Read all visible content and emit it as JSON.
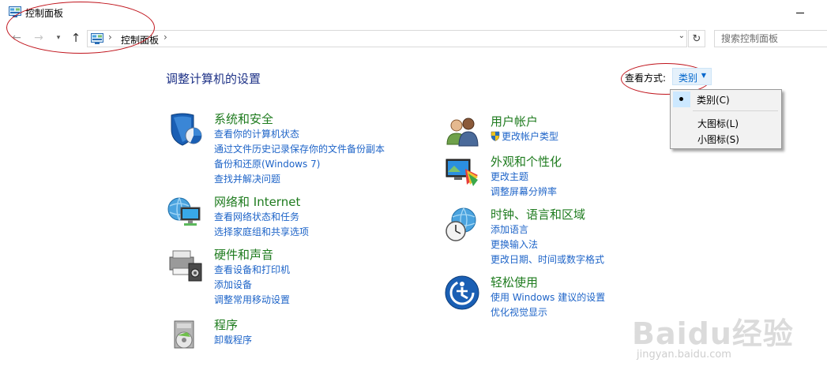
{
  "window": {
    "title": "控制面板"
  },
  "nav": {
    "breadcrumb": "控制面板",
    "search_placeholder": "搜索控制面板"
  },
  "main": {
    "heading": "调整计算机的设置",
    "view_by_label": "查看方式:",
    "view_by_value": "类别"
  },
  "view_menu": {
    "items": [
      "类别(C)",
      "大图标(L)",
      "小图标(S)"
    ],
    "selected": "类别(C)"
  },
  "categories": [
    {
      "title": "系统和安全",
      "icon": "system-security-icon",
      "links": [
        "查看你的计算机状态",
        "通过文件历史记录保存你的文件备份副本",
        "备份和还原(Windows 7)",
        "查找并解决问题"
      ]
    },
    {
      "title": "网络和 Internet",
      "icon": "network-internet-icon",
      "links": [
        "查看网络状态和任务",
        "选择家庭组和共享选项"
      ]
    },
    {
      "title": "硬件和声音",
      "icon": "hardware-sound-icon",
      "links": [
        "查看设备和打印机",
        "添加设备",
        "调整常用移动设置"
      ]
    },
    {
      "title": "程序",
      "icon": "programs-icon",
      "links": [
        "卸载程序"
      ]
    },
    {
      "title": "用户帐户",
      "icon": "user-accounts-icon",
      "links": [
        "更改帐户类型"
      ]
    },
    {
      "title": "外观和个性化",
      "icon": "appearance-icon",
      "links": [
        "更改主题",
        "调整屏幕分辨率"
      ]
    },
    {
      "title": "时钟、语言和区域",
      "icon": "clock-region-icon",
      "links": [
        "添加语言",
        "更换输入法",
        "更改日期、时间或数字格式"
      ]
    },
    {
      "title": "轻松使用",
      "icon": "ease-of-access-icon",
      "links": [
        "使用 Windows 建议的设置",
        "优化视觉显示"
      ]
    }
  ],
  "watermark": {
    "brand": "Baidu经验",
    "url": "jingyan.baidu.com"
  },
  "colors": {
    "heading": "#1e3287",
    "category_title": "#1e7b1e",
    "link": "#1e64c8",
    "annotation": "#c0141c"
  }
}
